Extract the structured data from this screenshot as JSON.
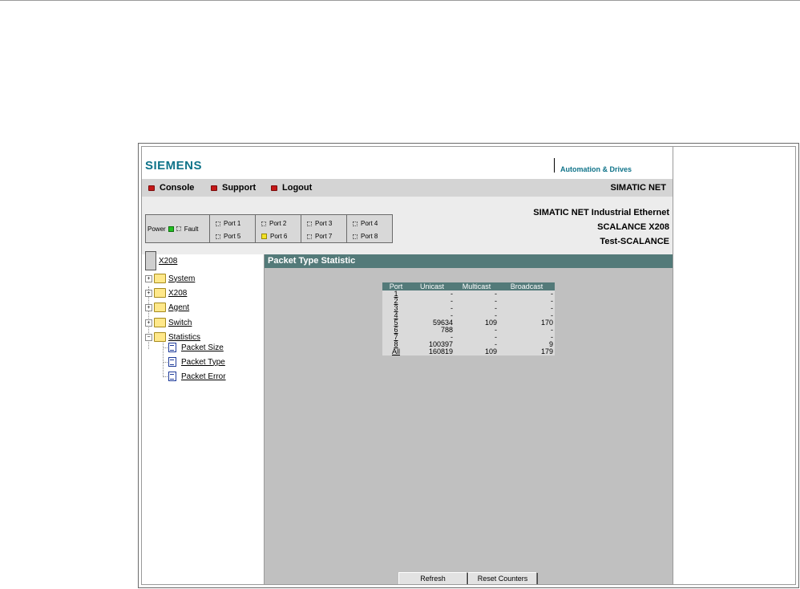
{
  "brand": {
    "logo": "SIEMENS",
    "division": "Automation & Drives",
    "product_line": "SIMATIC NET"
  },
  "nav": [
    {
      "label": "Console"
    },
    {
      "label": "Support"
    },
    {
      "label": "Logout"
    }
  ],
  "info": {
    "line1": "SIMATIC NET Industrial Ethernet",
    "line2": "SCALANCE X208",
    "line3": "Test-SCALANCE"
  },
  "port_panel": {
    "power": "Power",
    "fault": "Fault",
    "ports": [
      "Port 1",
      "Port 2",
      "Port 3",
      "Port 4",
      "Port 5",
      "Port 6",
      "Port 7",
      "Port 8"
    ],
    "port6_led": "yellow",
    "power_led": "green"
  },
  "tree": {
    "root": "X208",
    "folders": [
      "System",
      "X208",
      "Agent",
      "Switch",
      "Statistics"
    ],
    "pages": [
      "Packet Size",
      "Packet Type",
      "Packet Error"
    ]
  },
  "main": {
    "title": "Packet Type Statistic",
    "columns": [
      "Port",
      "Unicast",
      "Multicast",
      "Broadcast"
    ],
    "rows": [
      [
        "1",
        "-",
        "-",
        "-"
      ],
      [
        "2",
        "-",
        "-",
        "-"
      ],
      [
        "3",
        "-",
        "-",
        "-"
      ],
      [
        "4",
        "-",
        "-",
        "-"
      ],
      [
        "5",
        "59634",
        "109",
        "170"
      ],
      [
        "6",
        "788",
        "-",
        "-"
      ],
      [
        "7",
        "-",
        "-",
        "-"
      ],
      [
        "8",
        "100397",
        "-",
        "9"
      ],
      [
        "All",
        "160819",
        "109",
        "179"
      ]
    ],
    "buttons": {
      "refresh": "Refresh",
      "reset": "Reset Counters"
    }
  },
  "colors": {
    "brand_teal": "#0f7389",
    "header_bar": "#537a79",
    "content_bg": "#c0c0c0"
  }
}
